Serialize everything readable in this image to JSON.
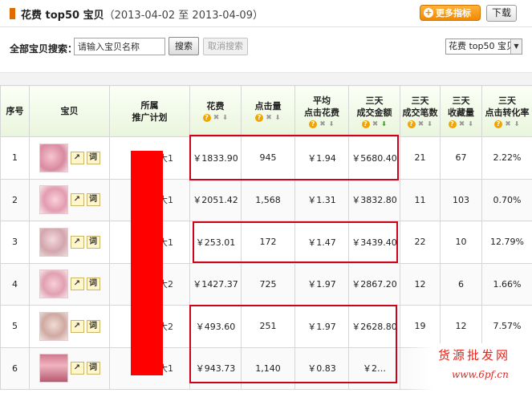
{
  "header": {
    "title": "花费 top50 宝贝",
    "date_range": "（2013-04-02 至 2013-04-09）",
    "more_metrics_label": "更多指标",
    "download_label": "下载"
  },
  "search": {
    "label": "全部宝贝搜索：",
    "placeholder": "请输入宝贝名称",
    "search_button": "搜索",
    "cancel_button": "取消搜索",
    "view_select": "花费 top50 宝贝"
  },
  "table": {
    "columns": [
      {
        "line1": "序号",
        "line2": ""
      },
      {
        "line1": "宝贝",
        "line2": ""
      },
      {
        "line1": "所属",
        "line2": "推广计划"
      },
      {
        "line1": "花费",
        "line2": ""
      },
      {
        "line1": "点击量",
        "line2": ""
      },
      {
        "line1": "平均",
        "line2": "点击花费"
      },
      {
        "line1": "三天",
        "line2": "成交金额"
      },
      {
        "line1": "三天",
        "line2": "成交笔数"
      },
      {
        "line1": "三天",
        "line2": "收藏量"
      },
      {
        "line1": "三天",
        "line2": "点击转化率"
      }
    ],
    "rows": [
      {
        "no": "1",
        "plan": "大1",
        "spend": "￥1833.90",
        "clicks": "945",
        "avg_cpc": "￥1.94",
        "sales": "￥5680.40",
        "orders": "21",
        "favs": "67",
        "cvr": "2.22%"
      },
      {
        "no": "2",
        "plan": "大1",
        "spend": "￥2051.42",
        "clicks": "1,568",
        "avg_cpc": "￥1.31",
        "sales": "￥3832.80",
        "orders": "11",
        "favs": "103",
        "cvr": "0.70%"
      },
      {
        "no": "3",
        "plan": "大1",
        "spend": "￥253.01",
        "clicks": "172",
        "avg_cpc": "￥1.47",
        "sales": "￥3439.40",
        "orders": "22",
        "favs": "10",
        "cvr": "12.79%"
      },
      {
        "no": "4",
        "plan": "大2",
        "spend": "￥1427.37",
        "clicks": "725",
        "avg_cpc": "￥1.97",
        "sales": "￥2867.20",
        "orders": "12",
        "favs": "6",
        "cvr": "1.66%"
      },
      {
        "no": "5",
        "plan": "大2",
        "spend": "￥493.60",
        "clicks": "251",
        "avg_cpc": "￥1.97",
        "sales": "￥2628.80",
        "orders": "19",
        "favs": "12",
        "cvr": "7.57%"
      },
      {
        "no": "6",
        "plan": "大1",
        "spend": "￥943.73",
        "clicks": "1,140",
        "avg_cpc": "￥0.83",
        "sales": "￥2…",
        "orders": "",
        "favs": "",
        "cvr": ""
      }
    ],
    "trend_icon": "trend-chart-icon",
    "keyword_button": "词"
  },
  "watermark": {
    "title": "货源批发网",
    "url": "www.6pf.cn"
  },
  "colors": {
    "accent": "#f08a00",
    "highlight_border": "#d0021b",
    "header_bg": "#e9f5dc"
  }
}
